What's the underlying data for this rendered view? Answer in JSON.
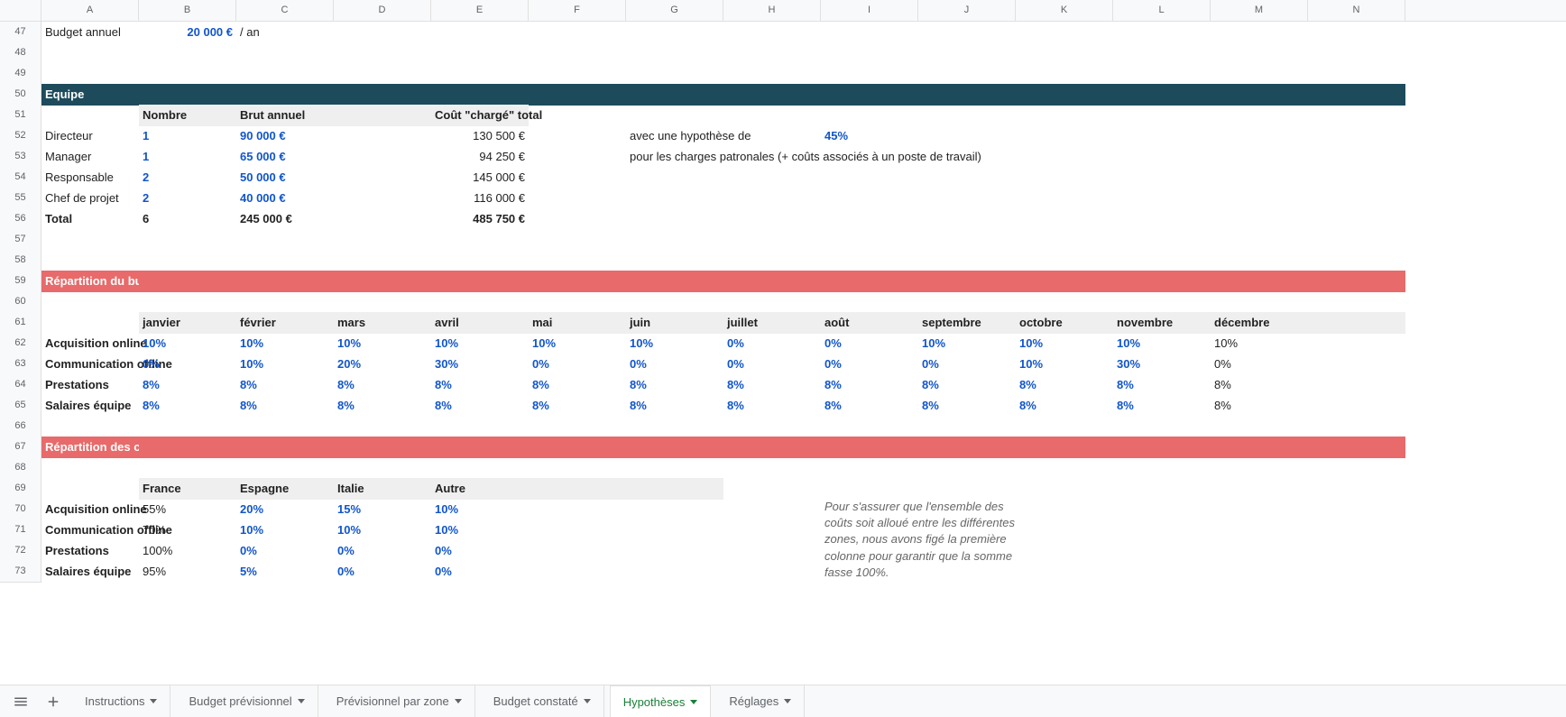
{
  "columns": [
    "A",
    "B",
    "C",
    "D",
    "E",
    "F",
    "G",
    "H",
    "I",
    "J",
    "K",
    "L",
    "M",
    "N"
  ],
  "rows": [
    47,
    48,
    49,
    50,
    51,
    52,
    53,
    54,
    55,
    56,
    57,
    58,
    59,
    60,
    61,
    62,
    63,
    64,
    65,
    66,
    67,
    68,
    69,
    70,
    71,
    72,
    73
  ],
  "budget": {
    "label": "Budget annuel",
    "value": "20 000 €",
    "unit": "/ an"
  },
  "sectionEquipe": "Equipe",
  "equipeHeaders": {
    "nombre": "Nombre",
    "brut": "Brut annuel",
    "cout": "Coût \"chargé\" total"
  },
  "equipe": [
    {
      "role": "Directeur",
      "n": "1",
      "brut": "90 000 €",
      "cout": "130 500 €"
    },
    {
      "role": "Manager",
      "n": "1",
      "brut": "65 000 €",
      "cout": "94 250 €"
    },
    {
      "role": "Responsable",
      "n": "2",
      "brut": "50 000 €",
      "cout": "145 000 €"
    },
    {
      "role": "Chef de projet",
      "n": "2",
      "brut": "40 000 €",
      "cout": "116 000 €"
    }
  ],
  "equipeTotal": {
    "label": "Total",
    "n": "6",
    "brut": "245 000 €",
    "cout": "485 750 €"
  },
  "hypotheseText": "avec une hypothèse de",
  "hypothesePct": "45%",
  "hypotheseNote": "pour les charges patronales (+ coûts associés à un poste de travail)",
  "sectionMois": "Répartition du budget par par mois",
  "months": [
    "janvier",
    "février",
    "mars",
    "avril",
    "mai",
    "juin",
    "juillet",
    "août",
    "septembre",
    "octobre",
    "novembre",
    "décembre"
  ],
  "repMois": [
    {
      "label": "Acquisition online",
      "vals": [
        "10%",
        "10%",
        "10%",
        "10%",
        "10%",
        "10%",
        "0%",
        "0%",
        "10%",
        "10%",
        "10%",
        "10%"
      ],
      "lastBlack": true
    },
    {
      "label": "Communication offline",
      "vals": [
        "0%",
        "10%",
        "20%",
        "30%",
        "0%",
        "0%",
        "0%",
        "0%",
        "0%",
        "10%",
        "30%",
        "0%"
      ],
      "lastBlack": true
    },
    {
      "label": "Prestations",
      "vals": [
        "8%",
        "8%",
        "8%",
        "8%",
        "8%",
        "8%",
        "8%",
        "8%",
        "8%",
        "8%",
        "8%",
        "8%"
      ],
      "lastBlack": true
    },
    {
      "label": "Salaires équipe",
      "vals": [
        "8%",
        "8%",
        "8%",
        "8%",
        "8%",
        "8%",
        "8%",
        "8%",
        "8%",
        "8%",
        "8%",
        "8%"
      ],
      "lastBlack": true
    }
  ],
  "sectionPays": "Répartition des coûts par pays / filiale",
  "paysHeaders": [
    "France",
    "Espagne",
    "Italie",
    "Autre"
  ],
  "repPays": [
    {
      "label": "Acquisition online",
      "vals": [
        "55%",
        "20%",
        "15%",
        "10%"
      ]
    },
    {
      "label": "Communication offline",
      "vals": [
        "70%",
        "10%",
        "10%",
        "10%"
      ]
    },
    {
      "label": "Prestations",
      "vals": [
        "100%",
        "0%",
        "0%",
        "0%"
      ]
    },
    {
      "label": "Salaires équipe",
      "vals": [
        "95%",
        "5%",
        "0%",
        "0%"
      ]
    }
  ],
  "note": "Pour s'assurer que l'ensemble des coûts soit alloué entre les différentes zones, nous avons figé la première colonne pour garantir que la somme fasse 100%.",
  "tabs": [
    "Instructions",
    "Budget prévisionnel",
    "Prévisionnel par zone",
    "Budget constaté",
    "Hypothèses",
    "Réglages"
  ],
  "activeTab": 4
}
